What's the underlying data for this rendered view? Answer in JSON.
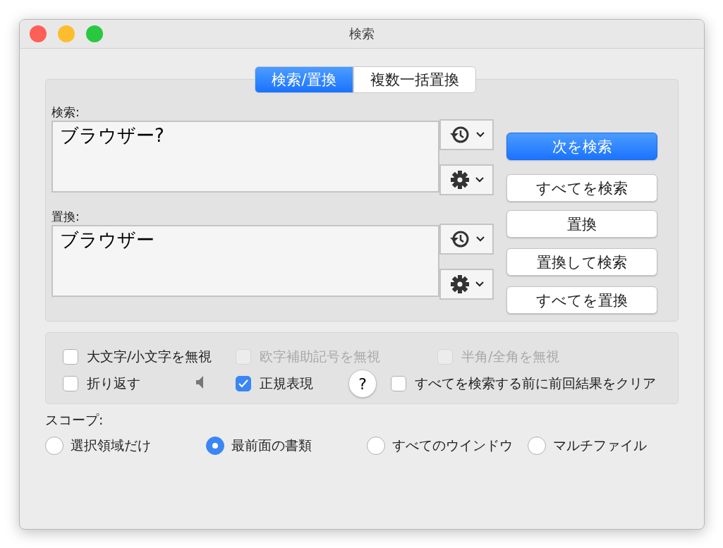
{
  "window": {
    "title": "検索"
  },
  "tabs": [
    {
      "label": "検索/置換",
      "selected": true
    },
    {
      "label": "複数一括置換",
      "selected": false
    }
  ],
  "find": {
    "label": "検索:",
    "value": "ブラウザー?"
  },
  "replace": {
    "label": "置換:",
    "value": "ブラウザー"
  },
  "find_buttons": [
    {
      "label": "次を検索",
      "default": true
    },
    {
      "label": "すべてを検索",
      "default": false
    }
  ],
  "replace_buttons": [
    {
      "label": "置換",
      "default": false
    },
    {
      "label": "置換して検索",
      "default": false
    },
    {
      "label": "すべてを置換",
      "default": false
    }
  ],
  "options": [
    [
      {
        "kind": "checkbox",
        "label": "大文字/小文字を無視",
        "checked": false,
        "disabled": false
      },
      {
        "kind": "checkbox",
        "label": "欧字補助記号を無視",
        "checked": false,
        "disabled": true
      },
      {
        "kind": "checkbox",
        "label": "半角/全角を無視",
        "checked": false,
        "disabled": true
      }
    ],
    [
      {
        "kind": "checkbox",
        "label": "折り返す",
        "checked": false,
        "disabled": false
      },
      {
        "kind": "speaker"
      },
      {
        "kind": "checkbox",
        "label": "正規表現",
        "checked": true,
        "disabled": false
      },
      {
        "kind": "help",
        "label": "?"
      },
      {
        "kind": "checkbox",
        "label": "すべてを検索する前に前回結果をクリア",
        "checked": false,
        "disabled": false
      }
    ]
  ],
  "scope": {
    "label": "スコープ:",
    "options": [
      {
        "label": "選択領域だけ",
        "selected": false
      },
      {
        "label": "最前面の書類",
        "selected": true
      },
      {
        "label": "すべてのウインドウ",
        "selected": false
      },
      {
        "label": "マルチファイル",
        "selected": false
      }
    ]
  }
}
